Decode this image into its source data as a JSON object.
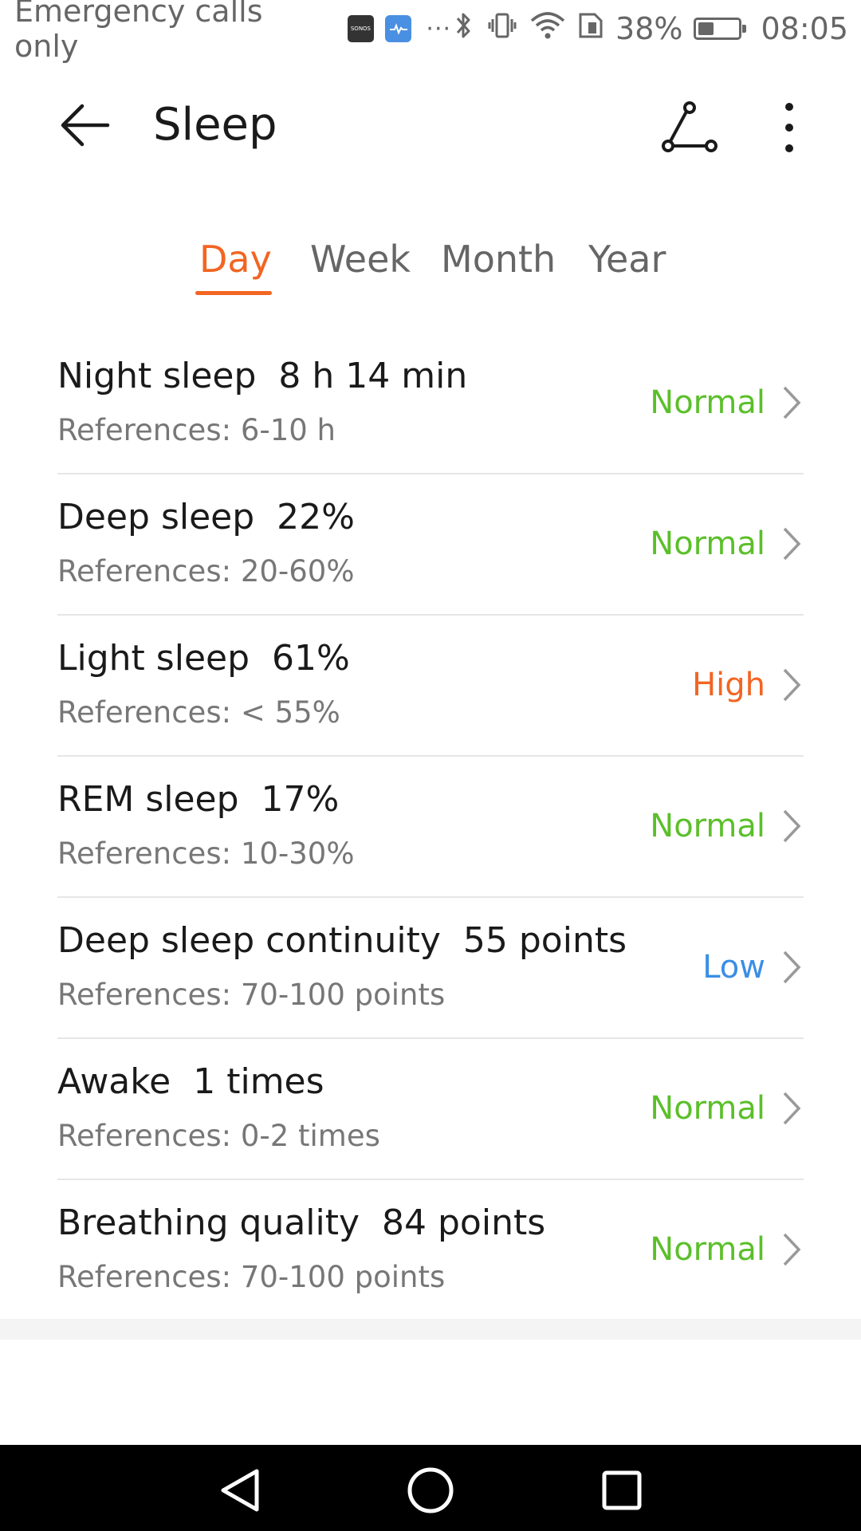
{
  "status_bar": {
    "carrier_text": "Emergency calls only",
    "sonos_label": "SONOS",
    "battery_percent": "38%",
    "battery_level": 0.38,
    "time": "08:05",
    "icons": [
      "sonos-icon",
      "health-app-icon",
      "more-notifications-icon",
      "bluetooth-icon",
      "vibrate-icon",
      "wifi-icon",
      "sim-icon",
      "battery-icon"
    ]
  },
  "header": {
    "title": "Sleep",
    "icons": [
      "back-arrow-icon",
      "share-icon",
      "more-vert-icon"
    ]
  },
  "tabs": [
    {
      "label": "Day",
      "active": true
    },
    {
      "label": "Week",
      "active": false
    },
    {
      "label": "Month",
      "active": false
    },
    {
      "label": "Year",
      "active": false
    }
  ],
  "metrics": [
    {
      "name": "Night sleep",
      "value": "8 h 14 min",
      "reference": "References: 6-10 h",
      "status": "Normal"
    },
    {
      "name": "Deep sleep",
      "value": "22%",
      "reference": "References: 20-60%",
      "status": "Normal"
    },
    {
      "name": "Light sleep",
      "value": "61%",
      "reference": "References: < 55%",
      "status": "High"
    },
    {
      "name": "REM sleep",
      "value": "17%",
      "reference": "References: 10-30%",
      "status": "Normal"
    },
    {
      "name": "Deep sleep continuity",
      "value": "55 points",
      "reference": "References: 70-100 points",
      "status": "Low"
    },
    {
      "name": "Awake",
      "value": "1 times",
      "reference": "References: 0-2 times",
      "status": "Normal"
    },
    {
      "name": "Breathing quality",
      "value": "84 points",
      "reference": "References: 70-100 points",
      "status": "Normal"
    }
  ],
  "colors": {
    "accent": "#f26522",
    "status_normal": "#5bbf2a",
    "status_high": "#f26522",
    "status_low": "#3a8ee6"
  },
  "nav_bar": {
    "icons": [
      "nav-back-icon",
      "nav-home-icon",
      "nav-recents-icon"
    ]
  }
}
